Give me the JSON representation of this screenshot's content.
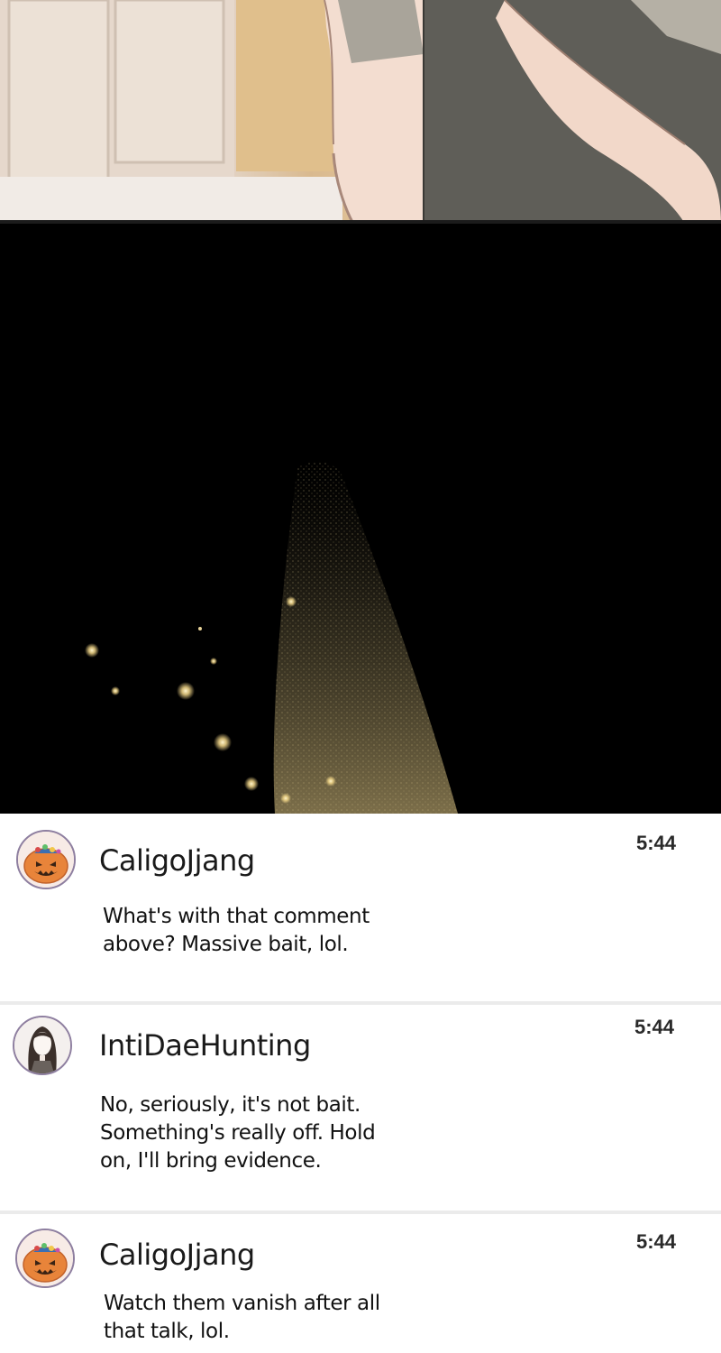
{
  "colors": {
    "background": "#ffffff",
    "divider": "#ebebeb",
    "text": "#1a1a1a",
    "glow": "#f5d98a"
  },
  "icons": {
    "caligo_avatar": "jack-o-lantern-avatar-icon",
    "inti_avatar": "long-hair-figure-avatar-icon"
  },
  "comments": [
    {
      "username": "CaligoJjang",
      "time": "5:44",
      "text": "What's with that comment\nabove? Massive bait, lol."
    },
    {
      "username": "IntiDaeHunting",
      "time": "5:44",
      "text": "No, seriously, it's not bait.\nSomething's really off. Hold\non, I'll bring evidence."
    },
    {
      "username": "CaligoJjang",
      "time": "5:44",
      "text": "Watch them vanish after all\nthat talk, lol."
    }
  ]
}
